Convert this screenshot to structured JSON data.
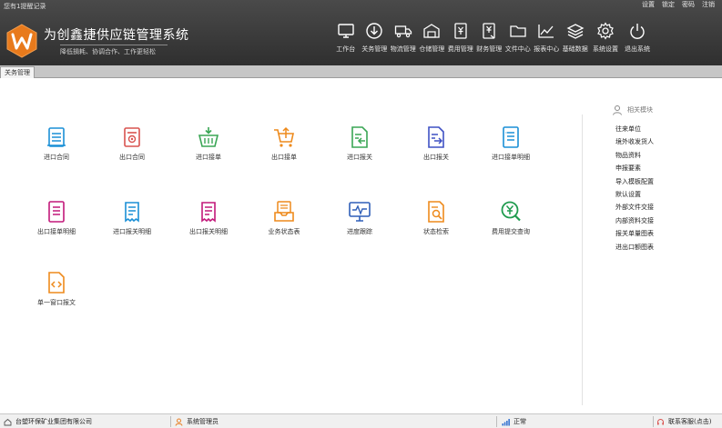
{
  "header": {
    "reminder": "您有1提醒记录",
    "window_links": [
      "设置",
      "锁定",
      "密码",
      "注销"
    ],
    "title": "为创鑫捷供应链管理系统",
    "slogan": "降低損耗、协调合作、工作更轻松",
    "nav": [
      {
        "label": "工作台",
        "icon": "monitor-icon"
      },
      {
        "label": "关务管理",
        "icon": "download-circle-icon"
      },
      {
        "label": "物流管理",
        "icon": "truck-icon"
      },
      {
        "label": "仓储管理",
        "icon": "warehouse-icon"
      },
      {
        "label": "费用管理",
        "icon": "yen-document-icon"
      },
      {
        "label": "财务管理",
        "icon": "finance-document-icon"
      },
      {
        "label": "文件中心",
        "icon": "folder-icon"
      },
      {
        "label": "报表中心",
        "icon": "line-chart-icon"
      },
      {
        "label": "基础数据",
        "icon": "layers-icon"
      },
      {
        "label": "系统设置",
        "icon": "gear-icon"
      },
      {
        "label": "退出系统",
        "icon": "power-icon"
      }
    ]
  },
  "tab": {
    "label": "关务管理"
  },
  "modules": {
    "m1": {
      "label": "进口合同",
      "color": "#1a8fd6"
    },
    "m2": {
      "label": "出口合同",
      "color": "#d9534f"
    },
    "m3": {
      "label": "进口接单",
      "color": "#3aa655"
    },
    "m4": {
      "label": "出口接单",
      "color": "#ee8a1c"
    },
    "m5": {
      "label": "进口报关",
      "color": "#3aa655"
    },
    "m6": {
      "label": "出口报关",
      "color": "#3f51c4"
    },
    "m7": {
      "label": "进口接单明细",
      "color": "#1a8fd6"
    },
    "m8": {
      "label": "出口接单明细",
      "color": "#c2187a"
    },
    "m9": {
      "label": "进口报关明细",
      "color": "#1a8fd6"
    },
    "m10": {
      "label": "出口报关明细",
      "color": "#c2187a"
    },
    "m11": {
      "label": "业务状态表",
      "color": "#ee8a1c"
    },
    "m12": {
      "label": "进度跟踪",
      "color": "#2f5fb8"
    },
    "m13": {
      "label": "状态检索",
      "color": "#ee8a1c"
    },
    "m14": {
      "label": "费用提交查询",
      "color": "#1f9b4e"
    },
    "m15": {
      "label": "单一窗口报文",
      "color": "#ee8a1c"
    }
  },
  "related": {
    "title": "相关模块",
    "items": [
      "往来单位",
      "境外收发货人",
      "物品资料",
      "申报要素",
      "导入模板配置",
      "默认设置",
      "外部文件交接",
      "内部资料交接",
      "报关单量图表",
      "进出口额图表"
    ]
  },
  "statusbar": {
    "company": "台塑环保矿业集团有限公司",
    "user": "系统管理员",
    "network": "正常",
    "support": "联系客服(点击)"
  }
}
